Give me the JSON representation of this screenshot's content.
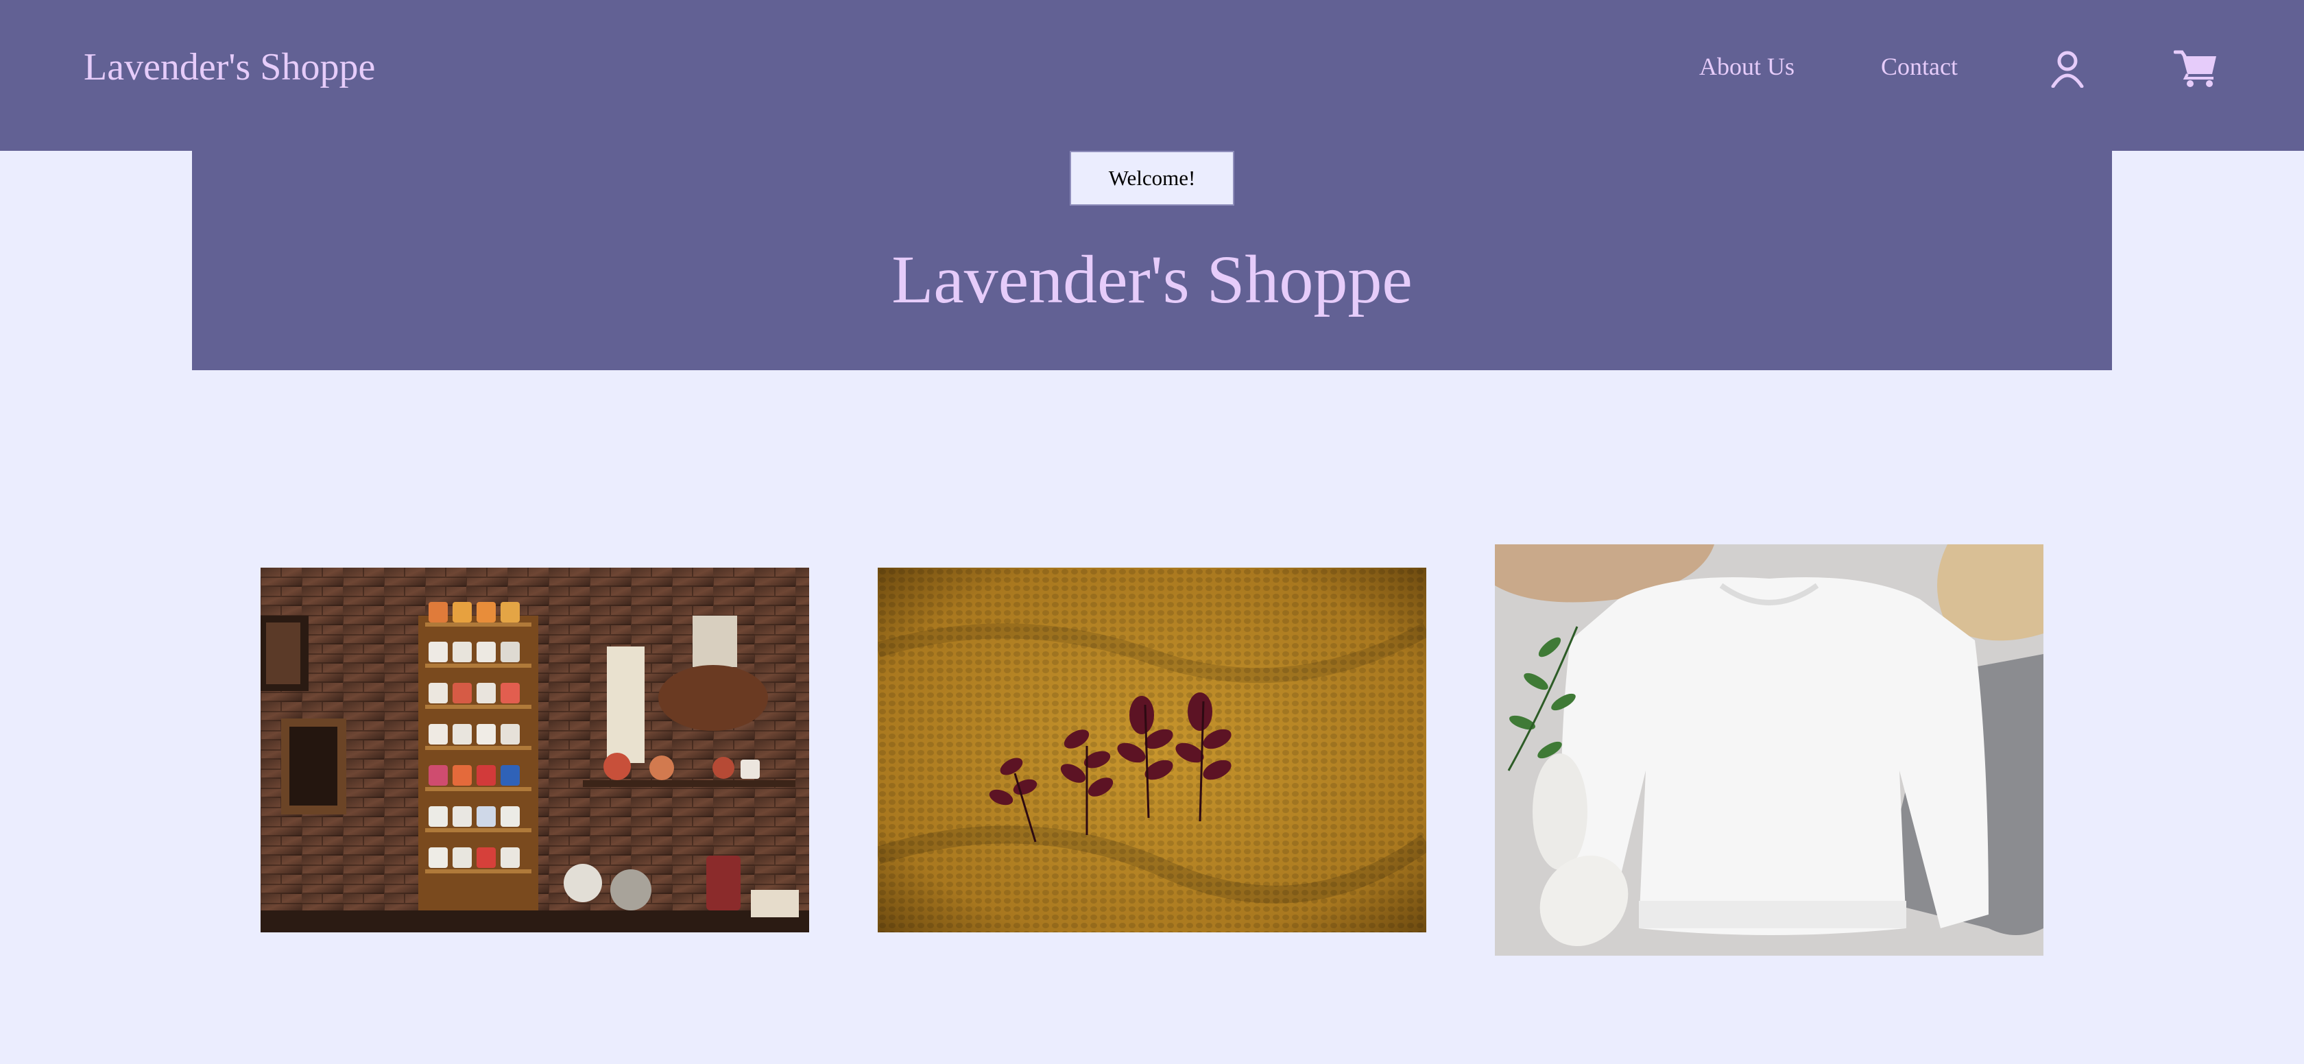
{
  "header": {
    "brand": "Lavender's Shoppe",
    "nav": {
      "about": "About Us",
      "contact": "Contact"
    },
    "icons": {
      "account": "user-icon",
      "cart": "cart-icon"
    }
  },
  "hero": {
    "welcome_label": "Welcome!",
    "title": "Lavender's Shoppe"
  },
  "gallery": {
    "images": [
      {
        "icon": "mug-shelf-photo"
      },
      {
        "icon": "knit-sweater-leaves-photo"
      },
      {
        "icon": "white-sweatshirt-flatlay-photo"
      }
    ]
  },
  "colors": {
    "background": "#ebedfe",
    "header": "#626194",
    "accent_text": "#e6ccfa"
  }
}
